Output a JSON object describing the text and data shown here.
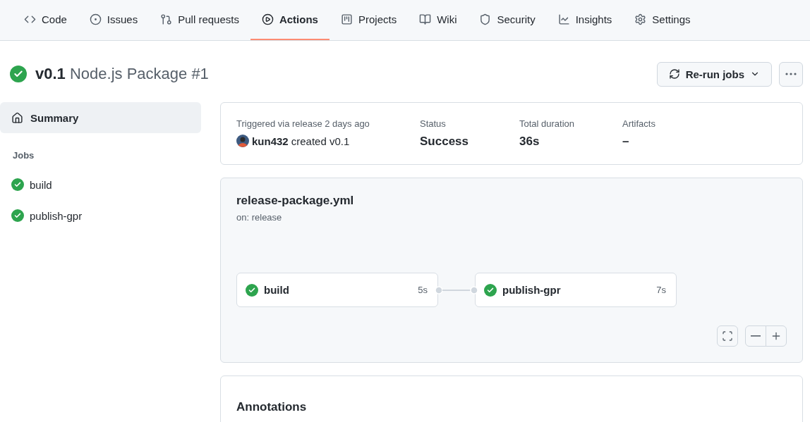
{
  "tabs": [
    {
      "label": "Code",
      "selected": false
    },
    {
      "label": "Issues",
      "selected": false
    },
    {
      "label": "Pull requests",
      "selected": false
    },
    {
      "label": "Actions",
      "selected": true
    },
    {
      "label": "Projects",
      "selected": false
    },
    {
      "label": "Wiki",
      "selected": false
    },
    {
      "label": "Security",
      "selected": false
    },
    {
      "label": "Insights",
      "selected": false
    },
    {
      "label": "Settings",
      "selected": false
    }
  ],
  "run": {
    "tag": "v0.1",
    "title": "Node.js Package #1"
  },
  "actions": {
    "rerun": "Re-run jobs"
  },
  "sidebar": {
    "summary": {
      "label": "Summary",
      "selected": true
    },
    "jobs_heading": "Jobs",
    "jobs": [
      {
        "name": "build"
      },
      {
        "name": "publish-gpr"
      }
    ]
  },
  "summary": {
    "trigger": "Triggered via release 2 days ago",
    "user": "kun432",
    "action": "created v0.1",
    "stats": [
      {
        "label": "Status",
        "value": "Success"
      },
      {
        "label": "Total duration",
        "value": "36s"
      },
      {
        "label": "Artifacts",
        "value": "–"
      }
    ]
  },
  "workflow": {
    "file": "release-package.yml",
    "on": "on: release",
    "jobs": [
      {
        "name": "build",
        "duration": "5s"
      },
      {
        "name": "publish-gpr",
        "duration": "7s"
      }
    ]
  },
  "annotations": {
    "title": "Annotations"
  }
}
